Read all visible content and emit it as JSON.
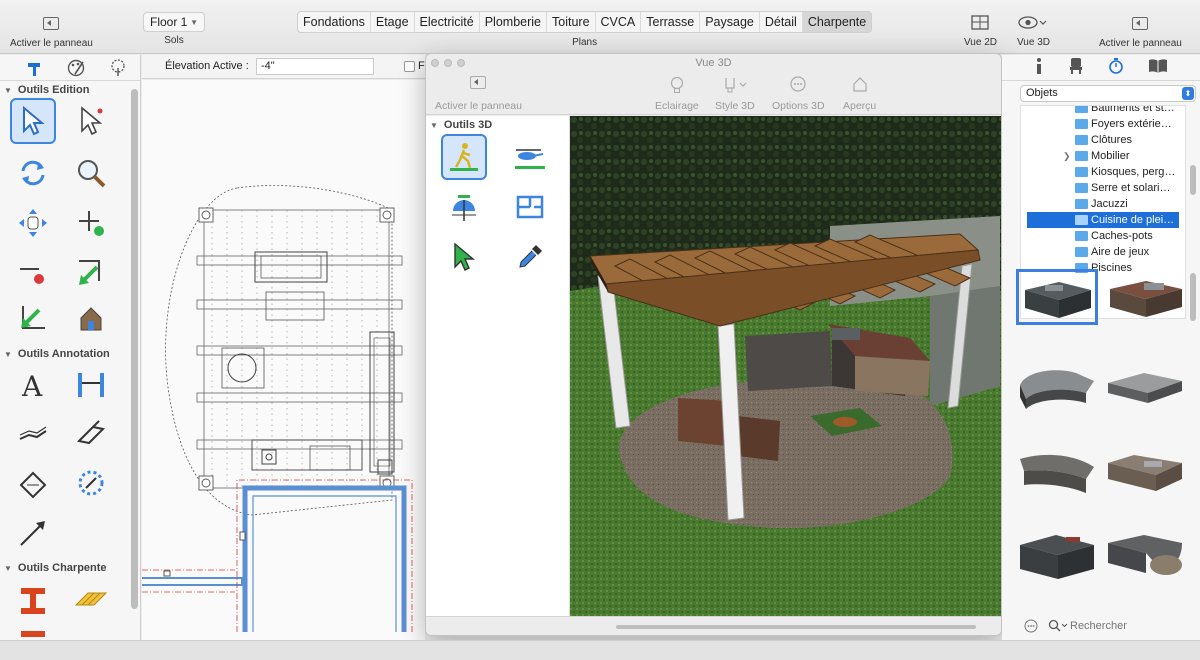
{
  "toolbar": {
    "left_panel_toggle": "Activer le panneau",
    "floor_select": "Floor 1",
    "floors_label": "Sols",
    "plans": [
      "Fondations",
      "Etage",
      "Electricité",
      "Plomberie",
      "Toiture",
      "CVCA",
      "Terrasse",
      "Paysage",
      "Détail",
      "Charpente"
    ],
    "active_plan": "Charpente",
    "plans_label": "Plans",
    "view2d": "Vue 2D",
    "view3d": "Vue 3D",
    "right_panel_toggle": "Activer le panneau"
  },
  "subheader": {
    "elevation_label": "Élevation Active :",
    "elevation_value": "-4\"",
    "fl_label": "Fl"
  },
  "left_panel": {
    "sections": [
      "Outils Edition",
      "Outils Annotation",
      "Outils Charpente"
    ]
  },
  "window3d": {
    "title": "Vue 3D",
    "panel_toggle": "Activer le panneau",
    "toolbar": [
      "Eclairage",
      "Style 3D",
      "Options 3D",
      "Aperçu"
    ],
    "tools_title": "Outils 3D"
  },
  "right_panel": {
    "category_select": "Objets",
    "tree": [
      {
        "label": "Batiments et st…",
        "expandable": false
      },
      {
        "label": "Foyers extérie…",
        "expandable": false
      },
      {
        "label": "Clôtures",
        "expandable": false
      },
      {
        "label": "Mobilier",
        "expandable": true
      },
      {
        "label": "Kiosques, perg…",
        "expandable": false
      },
      {
        "label": "Serre et solari…",
        "expandable": false
      },
      {
        "label": "Jacuzzi",
        "expandable": false
      },
      {
        "label": "Cuisine de plei…",
        "expandable": false,
        "selected": true
      },
      {
        "label": "Caches-pots",
        "expandable": false
      },
      {
        "label": "Aire de jeux",
        "expandable": false
      },
      {
        "label": "Piscines",
        "expandable": false
      }
    ],
    "search_placeholder": "Rechercher"
  },
  "colors": {
    "accent": "#1f6fdb",
    "selection_border": "#3d86e0",
    "plan_blue_wall": "#5b8fd4",
    "plan_red": "#d93a3a",
    "grass": "#3f6b2a"
  }
}
